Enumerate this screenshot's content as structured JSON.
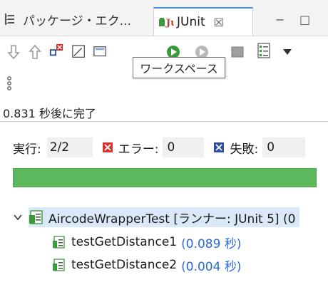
{
  "tabs": {
    "package_explorer_label": "パッケージ・エク...",
    "junit_label": "JUnit",
    "close_glyph": "☒"
  },
  "window_controls": {
    "minimize": "−",
    "maximize": "□"
  },
  "tooltip": {
    "text": "ワークスペース"
  },
  "status": {
    "finished": "0.831 秒後に完了"
  },
  "counters": {
    "runs_label": "実行:",
    "runs_value": "2/2",
    "errors_label": "エラー:",
    "errors_value": "0",
    "failures_label": "失敗:",
    "failures_value": "0"
  },
  "progress": {
    "fraction": 1.0,
    "color": "#5cb85c"
  },
  "tree": {
    "root_label": "AircodeWrapperTest [ランナー: JUnit 5] (0",
    "children": [
      {
        "name": "testGetDistance1",
        "time": "(0.089 秒)"
      },
      {
        "name": "testGetDistance2",
        "time": "(0.004 秒)"
      }
    ]
  },
  "icons": [
    "next-failure-icon",
    "previous-failure-icon",
    "show-failures-only-icon",
    "scroll-lock-icon",
    "history-icon",
    "rerun-icon",
    "rerun-failed-icon",
    "stop-icon",
    "layout-menu-icon",
    "view-menu-icon",
    "more-options-icon"
  ],
  "colors": {
    "accent": "#4a90e2",
    "success": "#5cb85c",
    "time_text": "#2a6ad8",
    "selection": "#dbe8f9"
  }
}
